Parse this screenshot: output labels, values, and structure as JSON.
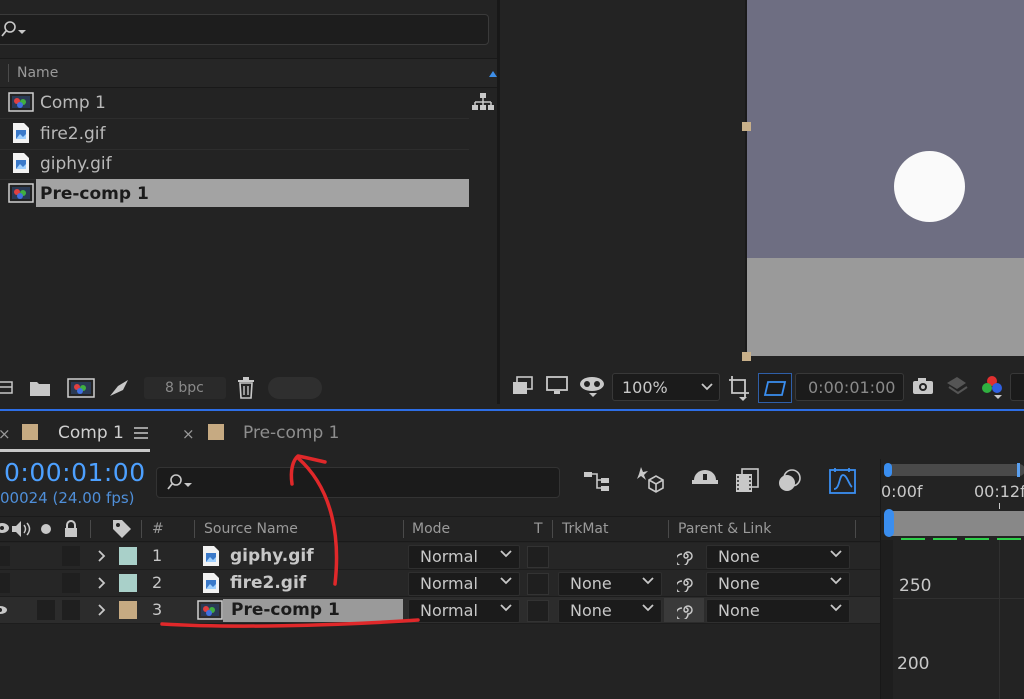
{
  "project_panel": {
    "header_name": "Name",
    "items": [
      {
        "label": "Comp 1",
        "type": "comp"
      },
      {
        "label": "fire2.gif",
        "type": "gif"
      },
      {
        "label": "giphy.gif",
        "type": "gif"
      },
      {
        "label": "Pre-comp 1",
        "type": "comp",
        "selected": true
      }
    ],
    "footer": {
      "bpc": "8 bpc"
    }
  },
  "viewer": {
    "zoom": "100%",
    "timecode": "0:00:01:00"
  },
  "timeline": {
    "tabs": [
      {
        "label": "Comp 1",
        "active": true
      },
      {
        "label": "Pre-comp 1",
        "active": false
      }
    ],
    "current_time": "0:00:01:00",
    "frame_info": "00024 (24.00 fps)",
    "columns": {
      "number": "#",
      "source_name": "Source Name",
      "mode": "Mode",
      "t": "T",
      "trkmat": "TrkMat",
      "parent": "Parent & Link"
    },
    "layers": [
      {
        "num": "1",
        "name": "giphy.gif",
        "mode": "Normal",
        "trkmat": "",
        "parent": "None",
        "color": "#a9d0c9"
      },
      {
        "num": "2",
        "name": "fire2.gif",
        "mode": "Normal",
        "trkmat": "None",
        "parent": "None",
        "color": "#a9d0c9"
      },
      {
        "num": "3",
        "name": "Pre-comp 1",
        "mode": "Normal",
        "trkmat": "None",
        "parent": "None",
        "color": "#c6aa82",
        "selected": true
      }
    ],
    "ruler": {
      "start": "0:00f",
      "mark": "00:12f"
    },
    "graph_labels": [
      "250",
      "200"
    ]
  },
  "colors": {
    "accent": "#2d6ee6",
    "timecode": "#4da0ff",
    "annotation": "#e0282a"
  }
}
